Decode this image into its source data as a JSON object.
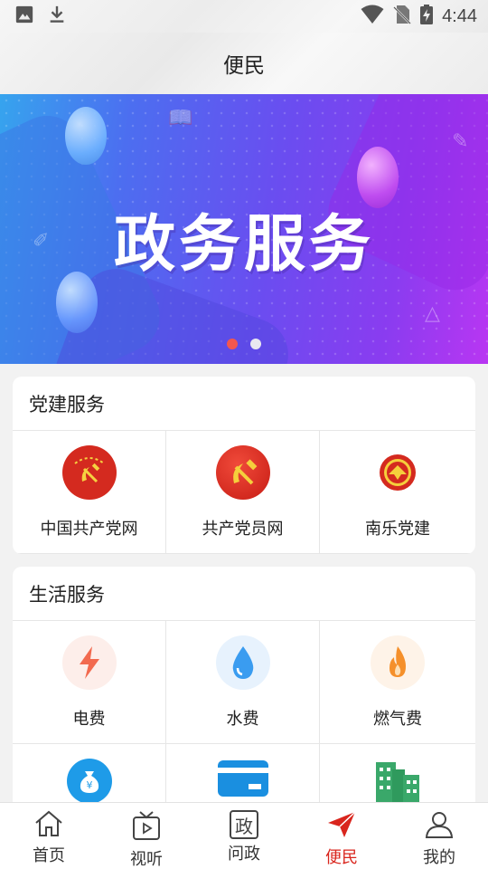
{
  "status_bar": {
    "time": "4:44"
  },
  "header": {
    "title": "便民"
  },
  "banner": {
    "headline": "政务服务",
    "slide_count": 2,
    "active_slide": 1
  },
  "sections": [
    {
      "title": "党建服务",
      "items": [
        {
          "label": "中国共产党网",
          "icon": "party-emblem-icon"
        },
        {
          "label": "共产党员网",
          "icon": "hammer-sickle-icon"
        },
        {
          "label": "南乐党建",
          "icon": "party-building-badge-icon"
        }
      ]
    },
    {
      "title": "生活服务",
      "items": [
        {
          "label": "电费",
          "icon": "lightning-icon",
          "color": "#f26a4f"
        },
        {
          "label": "水费",
          "icon": "water-drop-icon",
          "color": "#3a9cf0"
        },
        {
          "label": "燃气费",
          "icon": "flame-icon",
          "color": "#f5902b"
        },
        {
          "label": "",
          "icon": "money-bag-icon",
          "color": "#1e9be8"
        },
        {
          "label": "",
          "icon": "card-icon",
          "color": "#1a8fe0"
        },
        {
          "label": "",
          "icon": "building-icon",
          "color": "#3aa86a"
        }
      ]
    }
  ],
  "tabbar": {
    "active_color": "#d9251d",
    "items": [
      {
        "label": "首页",
        "icon": "home-icon"
      },
      {
        "label": "视听",
        "icon": "tv-icon"
      },
      {
        "label": "问政",
        "icon": "zheng-icon",
        "glyph": "政"
      },
      {
        "label": "便民",
        "icon": "paper-plane-icon",
        "active": true
      },
      {
        "label": "我的",
        "icon": "user-icon"
      }
    ]
  }
}
